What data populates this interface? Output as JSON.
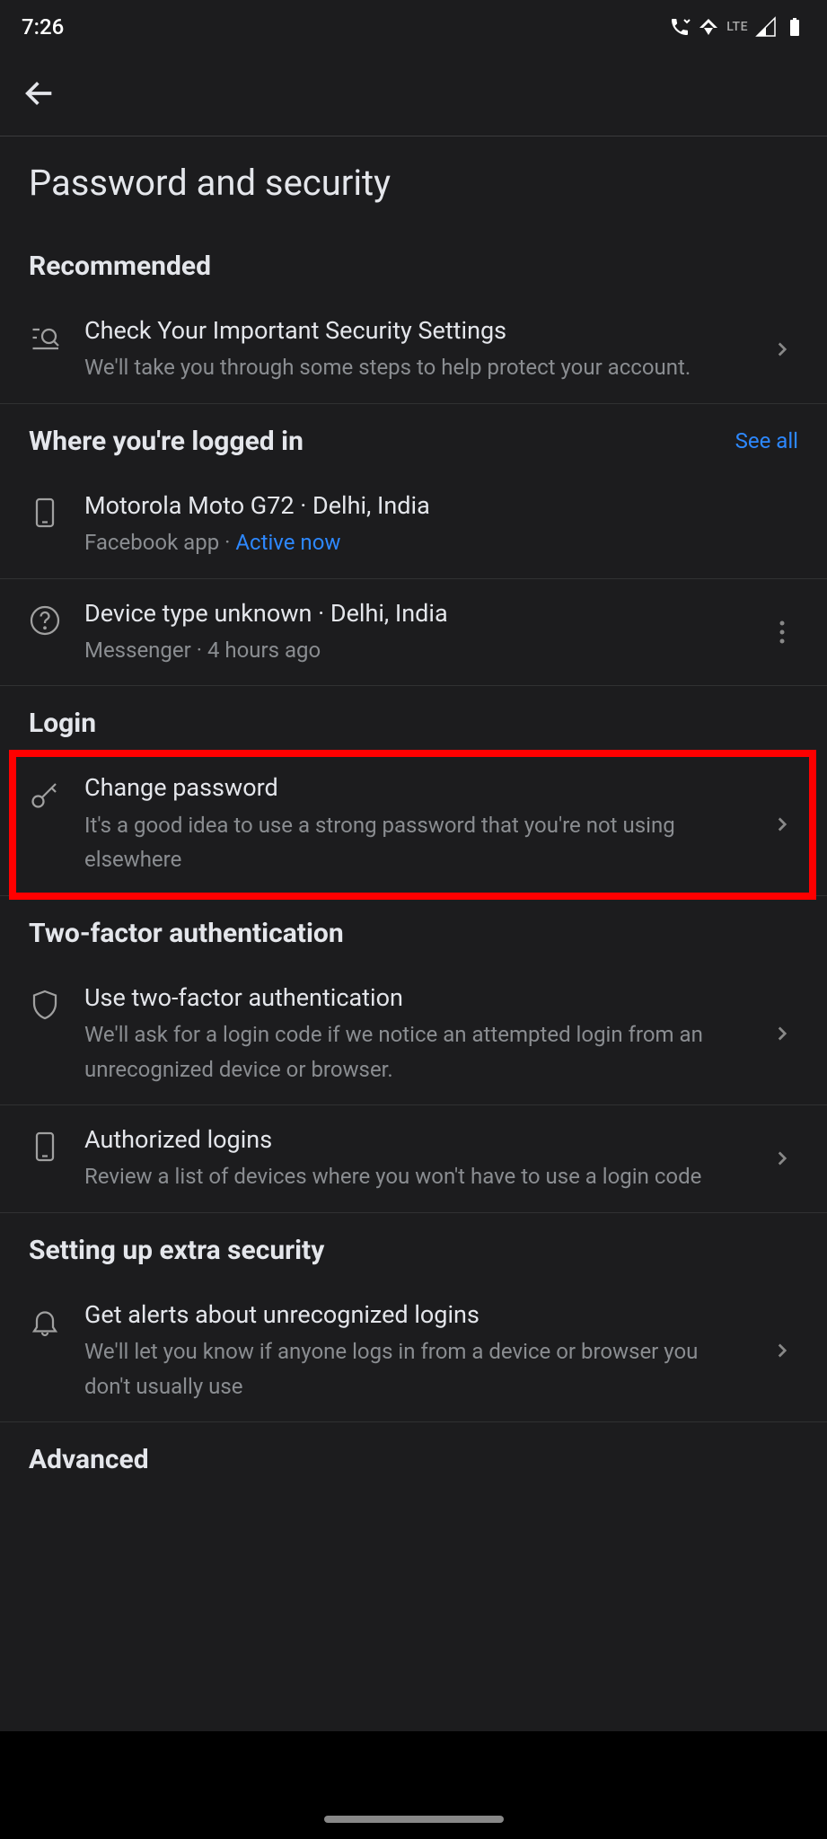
{
  "status": {
    "time": "7:26",
    "network": "LTE"
  },
  "page": {
    "title": "Password and security"
  },
  "sections": {
    "recommended": {
      "header": "Recommended",
      "item": {
        "title": "Check Your Important Security Settings",
        "sub": "We'll take you through some steps to help protect your account."
      }
    },
    "logged_in": {
      "header": "Where you're logged in",
      "see_all": "See all",
      "devices": [
        {
          "title": "Motorola Moto G72 · Delhi, India",
          "app": "Facebook app · ",
          "status": "Active now"
        },
        {
          "title": "Device type unknown · Delhi, India",
          "sub": "Messenger · 4 hours ago"
        }
      ]
    },
    "login": {
      "header": "Login",
      "item": {
        "title": "Change password",
        "sub": "It's a good idea to use a strong password that you're not using elsewhere"
      }
    },
    "two_factor": {
      "header": "Two-factor authentication",
      "items": [
        {
          "title": "Use two-factor authentication",
          "sub": "We'll ask for a login code if we notice an attempted login from an unrecognized device or browser."
        },
        {
          "title": "Authorized logins",
          "sub": "Review a list of devices where you won't have to use a login code"
        }
      ]
    },
    "extra_security": {
      "header": "Setting up extra security",
      "item": {
        "title": "Get alerts about unrecognized logins",
        "sub": "We'll let you know if anyone logs in from a device or browser you don't usually use"
      }
    },
    "advanced": {
      "header": "Advanced"
    }
  }
}
